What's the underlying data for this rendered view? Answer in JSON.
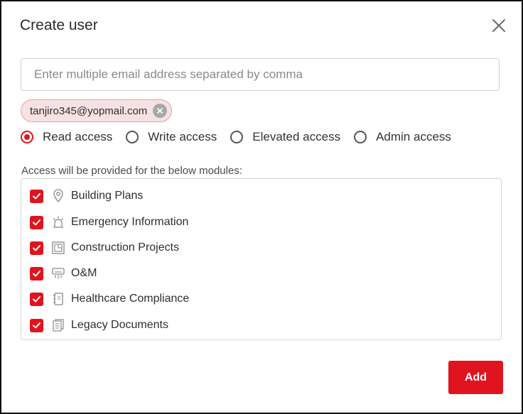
{
  "dialog": {
    "title": "Create user",
    "close_icon": "close-icon"
  },
  "email": {
    "placeholder": "Enter multiple email address separated by comma",
    "value": ""
  },
  "chips": [
    {
      "label": "tanjiro345@yopmail.com",
      "remove_icon": "remove-circle-icon"
    }
  ],
  "access": {
    "selected": "Read access",
    "options": [
      {
        "label": "Read access",
        "checked": true
      },
      {
        "label": "Write access",
        "checked": false
      },
      {
        "label": "Elevated access",
        "checked": false
      },
      {
        "label": "Admin access",
        "checked": false
      }
    ]
  },
  "modules": {
    "heading": "Access will be provided for the below modules:",
    "items": [
      {
        "label": "Building Plans",
        "icon": "map-pin-icon",
        "checked": true
      },
      {
        "label": "Emergency Information",
        "icon": "alarm-light-icon",
        "checked": true
      },
      {
        "label": "Construction Projects",
        "icon": "blueprint-icon",
        "checked": true
      },
      {
        "label": "O&M",
        "icon": "air-conditioner-icon",
        "checked": true
      },
      {
        "label": "Healthcare Compliance",
        "icon": "notebook-icon",
        "checked": true
      },
      {
        "label": "Legacy Documents",
        "icon": "documents-icon",
        "checked": true
      }
    ]
  },
  "actions": {
    "add_label": "Add"
  },
  "colors": {
    "accent": "#e0141e",
    "chip_bg": "#f6e2e2",
    "border": "#d4d4d4"
  }
}
